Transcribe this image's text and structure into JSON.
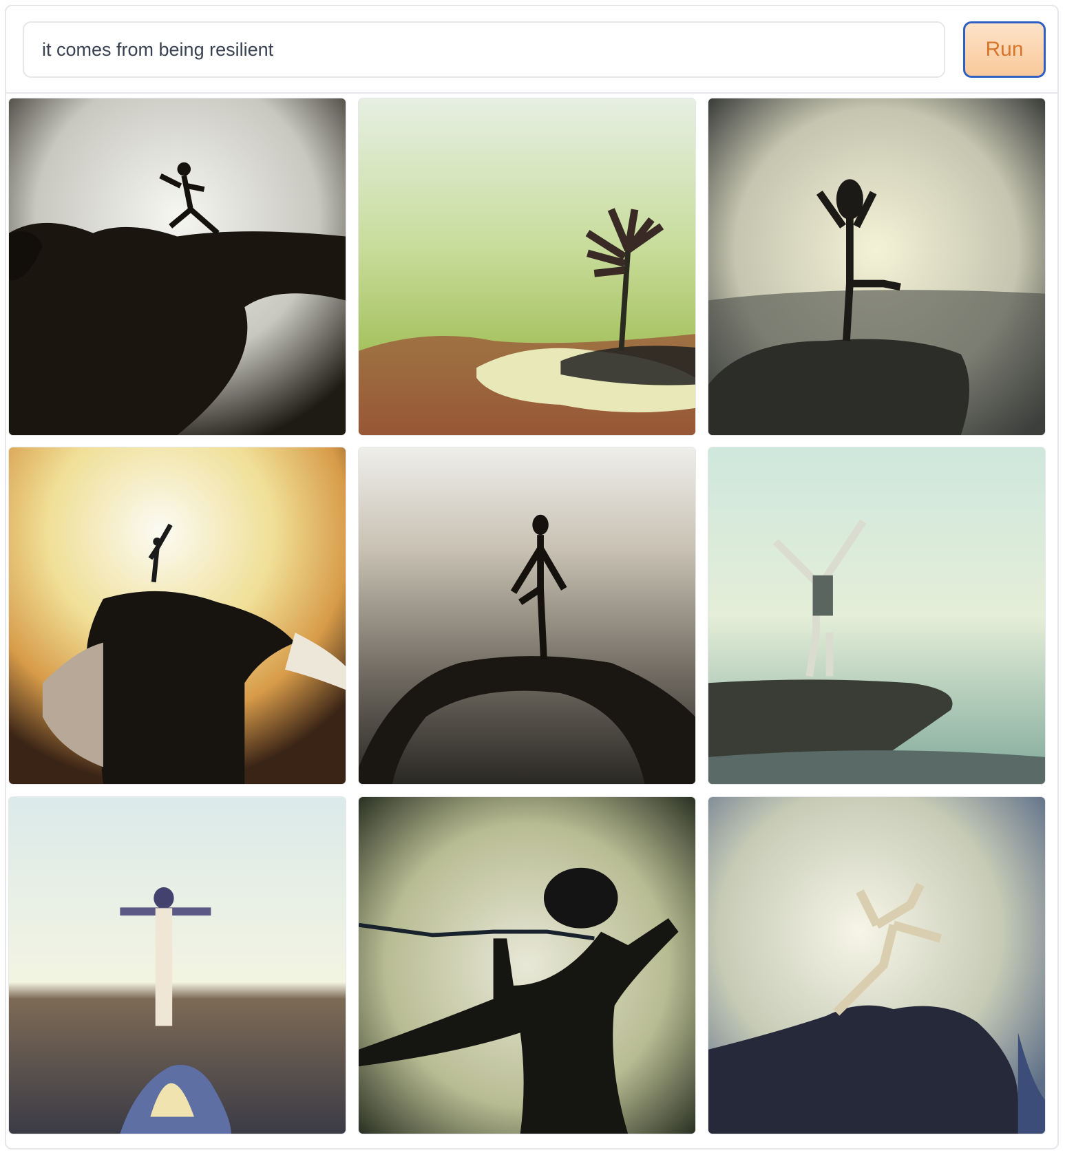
{
  "prompt": {
    "value": "it comes from being resilient"
  },
  "actions": {
    "run_label": "Run"
  },
  "gallery": {
    "images": [
      {
        "name": "image-1",
        "desc_icon": "silhouette-leaping-on-rock"
      },
      {
        "name": "image-2",
        "desc_icon": "hand-holding-plant"
      },
      {
        "name": "image-3",
        "desc_icon": "figure-on-rock-balancing"
      },
      {
        "name": "image-4",
        "desc_icon": "figure-on-giant-hand"
      },
      {
        "name": "image-5",
        "desc_icon": "figure-on-arch"
      },
      {
        "name": "image-6",
        "desc_icon": "figure-arms-raised-on-cliff"
      },
      {
        "name": "image-7",
        "desc_icon": "figure-arms-spread-horizon"
      },
      {
        "name": "image-8",
        "desc_icon": "shadow-figure-wall"
      },
      {
        "name": "image-9",
        "desc_icon": "figure-leaping-off-rock"
      }
    ]
  },
  "colors": {
    "accent_border": "#2f5fc2",
    "run_text": "#d9742b",
    "run_bg": "#f9c99a"
  }
}
